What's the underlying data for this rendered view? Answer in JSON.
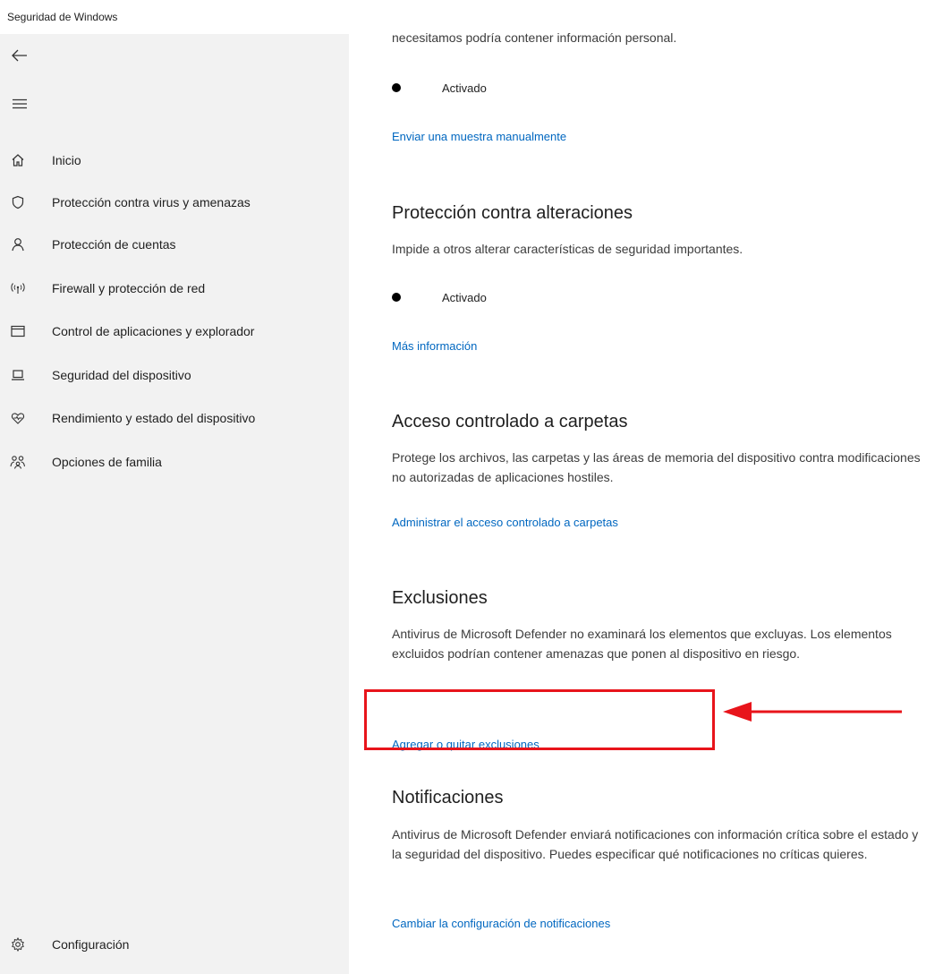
{
  "window": {
    "title": "Seguridad de Windows"
  },
  "nav": {
    "back_icon": "back-arrow-icon",
    "menu_icon": "hamburger-menu-icon",
    "items": [
      {
        "label": "Inicio",
        "icon": "home-icon"
      },
      {
        "label": "Protección contra virus y amenazas",
        "icon": "shield-icon"
      },
      {
        "label": "Protección de cuentas",
        "icon": "person-icon"
      },
      {
        "label": "Firewall y protección de red",
        "icon": "wifi-signal-icon"
      },
      {
        "label": "Control de aplicaciones y explorador",
        "icon": "browser-window-icon"
      },
      {
        "label": "Seguridad del dispositivo",
        "icon": "laptop-icon"
      },
      {
        "label": "Rendimiento y estado del dispositivo",
        "icon": "heart-pulse-icon"
      },
      {
        "label": "Opciones de familia",
        "icon": "family-icon"
      }
    ],
    "settings": {
      "label": "Configuración",
      "icon": "gear-icon"
    }
  },
  "content": {
    "cut_text": "necesitamos podría contener información personal.",
    "sample_submission": {
      "toggle_label": "Activado",
      "link": "Enviar una muestra manualmente"
    },
    "tamper_protection": {
      "title": "Protección contra alteraciones",
      "desc": "Impide a otros alterar características de seguridad importantes.",
      "toggle_label": "Activado",
      "link": "Más información"
    },
    "controlled_folder": {
      "title": "Acceso controlado a carpetas",
      "desc": "Protege los archivos, las carpetas y las áreas de memoria del dispositivo contra modificaciones no autorizadas de aplicaciones hostiles.",
      "link": "Administrar el acceso controlado a carpetas"
    },
    "exclusions": {
      "title": "Exclusiones",
      "desc": "Antivirus de Microsoft Defender no examinará los elementos que excluyas. Los elementos excluidos podrían contener amenazas que ponen al dispositivo en riesgo.",
      "link": "Agregar o quitar exclusiones"
    },
    "notifications": {
      "title": "Notificaciones",
      "desc": "Antivirus de Microsoft Defender enviará notificaciones con información crítica sobre el estado y la seguridad del dispositivo. Puedes especificar qué notificaciones no críticas quieres.",
      "link": "Cambiar la configuración de notificaciones"
    }
  },
  "annotation": {
    "color": "#e8141b"
  },
  "colors": {
    "link": "#0067c0",
    "sidebar_bg": "#f2f2f2"
  }
}
